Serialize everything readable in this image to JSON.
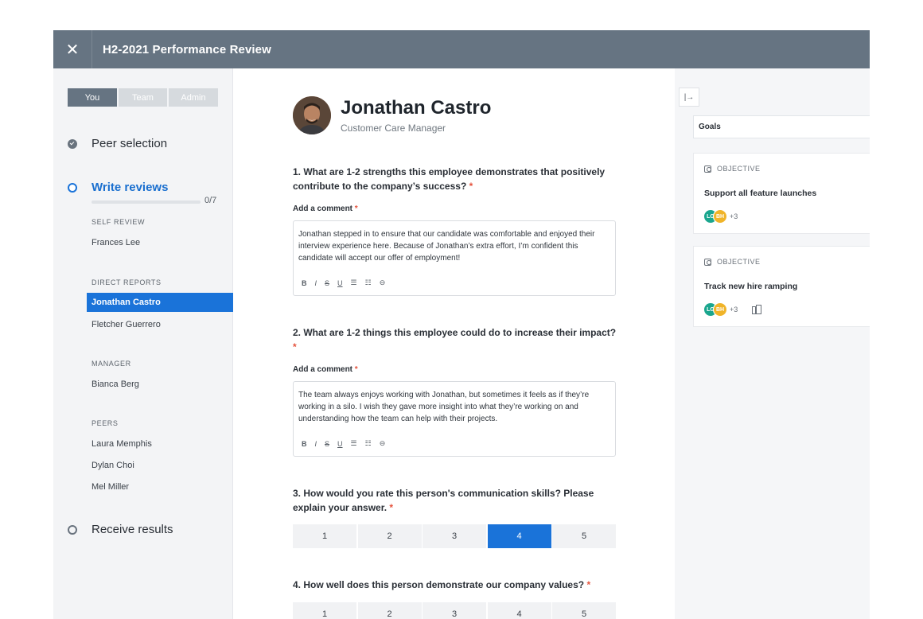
{
  "header": {
    "close_glyph": "✕",
    "title": "H2-2021 Performance Review"
  },
  "sidebar": {
    "tabs": [
      {
        "label": "You",
        "active": true
      },
      {
        "label": "Team",
        "active": false
      },
      {
        "label": "Admin",
        "active": false
      }
    ],
    "steps": {
      "peer": "Peer selection",
      "write": "Write reviews",
      "receive": "Receive results"
    },
    "progress": {
      "text": "0/7",
      "value": 0
    },
    "groups": {
      "self": {
        "label": "SELF REVIEW",
        "people": [
          "Frances Lee"
        ]
      },
      "direct": {
        "label": "DIRECT REPORTS",
        "selected": "Jonathan Castro",
        "people": [
          "Fletcher Guerrero"
        ]
      },
      "manager": {
        "label": "MANAGER",
        "people": [
          "Bianca Berg"
        ]
      },
      "peers": {
        "label": "PEERS",
        "people": [
          "Laura Memphis",
          "Dylan Choi",
          "Mel Miller"
        ]
      }
    }
  },
  "main": {
    "employee": {
      "name": "Jonathan Castro",
      "role": "Customer Care Manager"
    },
    "required_mark": "*",
    "comment_label": "Add a comment",
    "toolbar": [
      "B",
      "I",
      "S",
      "U",
      "☰",
      "☷",
      "⊖"
    ],
    "q1": {
      "text": "1. What are 1-2 strengths this employee demonstrates that positively contribute to the company’s success?",
      "comment": "Jonathan stepped in to ensure that our candidate was comfortable and enjoyed their interview experience here. Because of Jonathan’s extra effort, I’m confident this candidate will accept our offer of employment!"
    },
    "q2": {
      "text": "2. What are 1-2 things this employee could do to increase their impact?",
      "comment": "The team always enjoys working with Jonathan, but sometimes it feels as if they’re working in a silo. I wish they gave more insight into what they’re working on and understanding how the team can help with their projects."
    },
    "q3": {
      "text": "3. How would you rate this person's communication skills? Please explain your answer.",
      "options": [
        "1",
        "2",
        "3",
        "4",
        "5"
      ],
      "selected": "4"
    },
    "q4": {
      "text": "4. How well does this person demonstrate our company values?",
      "options": [
        "1",
        "2",
        "3",
        "4",
        "5"
      ]
    }
  },
  "right_panel": {
    "collapse_glyph": "|→",
    "dropdown": "Goals",
    "cards": [
      {
        "type": "OBJECTIVE",
        "title": "Support all feature launches",
        "avatars": [
          "LG",
          "BH"
        ],
        "more": "+3"
      },
      {
        "type": "OBJECTIVE",
        "title": "Track new hire ramping",
        "avatars": [
          "LG",
          "BH"
        ],
        "more": "+3"
      }
    ]
  },
  "colors": {
    "header": "#667482",
    "accent": "#1a73d9",
    "required": "#e5533d"
  }
}
